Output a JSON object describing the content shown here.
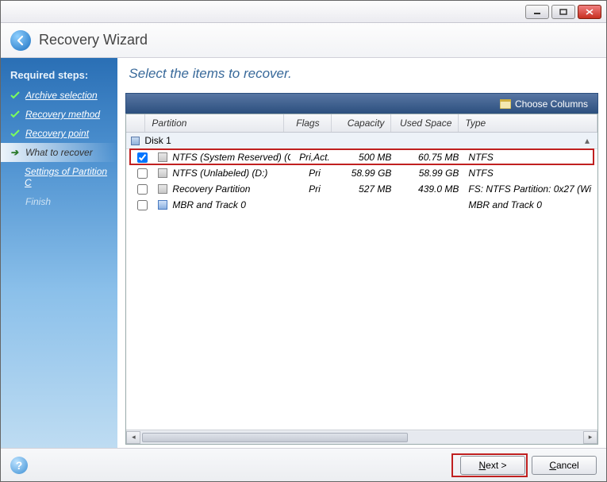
{
  "window": {
    "title": "Recovery Wizard"
  },
  "sidebar": {
    "title": "Required steps:",
    "steps": [
      {
        "label": "Archive selection"
      },
      {
        "label": "Recovery method"
      },
      {
        "label": "Recovery point"
      }
    ],
    "current": "What to recover",
    "sub": "Settings of Partition C",
    "disabled": "Finish"
  },
  "content": {
    "title": "Select the items to recover.",
    "toolbar": {
      "choose_columns": "Choose Columns"
    },
    "columns": {
      "partition": "Partition",
      "flags": "Flags",
      "capacity": "Capacity",
      "used": "Used Space",
      "type": "Type"
    },
    "group": "Disk 1",
    "rows": [
      {
        "checked": true,
        "name": "NTFS (System Reserved) (C:)",
        "flags": "Pri,Act.",
        "capacity": "500 MB",
        "used": "60.75 MB",
        "type": "NTFS"
      },
      {
        "checked": false,
        "name": "NTFS (Unlabeled) (D:)",
        "flags": "Pri",
        "capacity": "58.99 GB",
        "used": "58.99 GB",
        "type": "NTFS"
      },
      {
        "checked": false,
        "name": "Recovery Partition",
        "flags": "Pri",
        "capacity": "527 MB",
        "used": "439.0 MB",
        "type": "FS: NTFS Partition: 0x27 (Wi"
      },
      {
        "checked": false,
        "name": "MBR and Track 0",
        "flags": "",
        "capacity": "",
        "used": "",
        "type": "MBR and Track 0",
        "blue": true
      }
    ]
  },
  "footer": {
    "next": "Next >",
    "cancel": "Cancel"
  }
}
